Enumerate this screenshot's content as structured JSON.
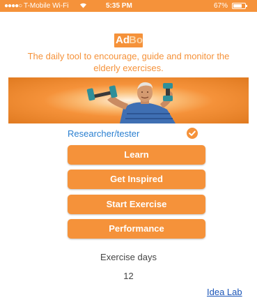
{
  "status_bar": {
    "signal": "●●●●○",
    "carrier": "T-Mobile Wi-Fi",
    "time": "5:35 PM",
    "battery": "67%",
    "battery_level": 0.67
  },
  "logo": {
    "part1": "Ad",
    "part2": "Bo"
  },
  "tagline": "The daily tool to encourage, guide and monitor the elderly exercises.",
  "role": {
    "label": "Researcher/tester",
    "selected": true
  },
  "menu": {
    "learn": "Learn",
    "get_inspired": "Get Inspired",
    "start_exercise": "Start Exercise",
    "performance": "Performance"
  },
  "stats": {
    "label": "Exercise days",
    "value": "12"
  },
  "footer": {
    "link": "Idea Lab"
  },
  "colors": {
    "accent": "#f5923a",
    "role_text": "#2a7fd0",
    "link": "#1a55b8",
    "white": "#ffffff"
  }
}
